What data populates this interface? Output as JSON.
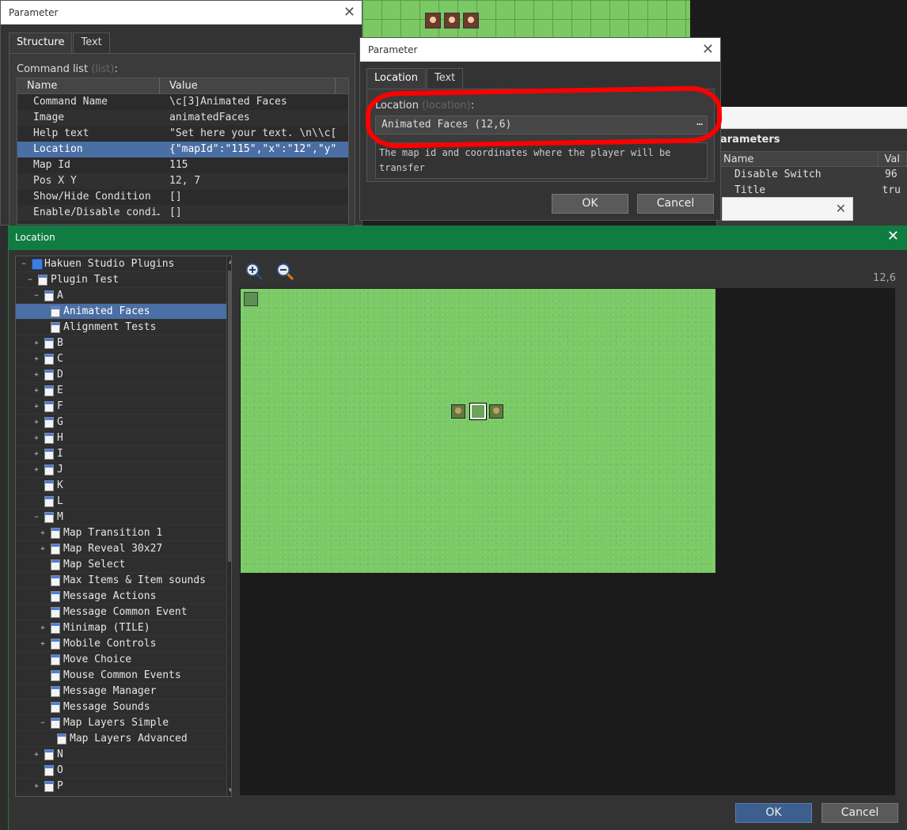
{
  "background": {
    "parameters_panel": {
      "title": "arameters",
      "columns": [
        "Name",
        "Val"
      ],
      "rows": [
        {
          "name": "Disable Switch",
          "value": "96"
        },
        {
          "name": "Title",
          "value": "tru"
        }
      ]
    }
  },
  "param_dialog_1": {
    "title": "Parameter",
    "tabs": [
      "Structure",
      "Text"
    ],
    "command_list_label": "Command list",
    "command_list_hint": "(list)",
    "columns": {
      "name": "Name",
      "value": "Value"
    },
    "rows": [
      {
        "name": "Command Name",
        "value": "\\c[3]Animated Faces"
      },
      {
        "name": "Image",
        "value": "animatedFaces"
      },
      {
        "name": "Help text",
        "value": "\"Set here your text. \\n\\\\c[…"
      },
      {
        "name": "Location",
        "value": "{\"mapId\":\"115\",\"x\":\"12\",\"y\"…"
      },
      {
        "name": "Map Id",
        "value": "115"
      },
      {
        "name": "Pos X Y",
        "value": "12, 7"
      },
      {
        "name": "Show/Hide Condition",
        "value": "[]"
      },
      {
        "name": "Enable/Disable condi…",
        "value": "[]"
      }
    ],
    "selected_row": 3
  },
  "param_dialog_2": {
    "title": "Parameter",
    "tabs": [
      "Location",
      "Text"
    ],
    "field_label": "Location",
    "field_hint": "(location)",
    "field_suffix": ":",
    "field_value": "Animated Faces (12,6)",
    "field_button": "…",
    "description": "The map id and coordinates where the player will be transfer",
    "ok_label": "OK",
    "cancel_label": "Cancel"
  },
  "location_dialog": {
    "title": "Location",
    "coordinate_readout": "12,6",
    "ok_label": "OK",
    "cancel_label": "Cancel",
    "tree": [
      {
        "label": "Hakuen Studio Plugins",
        "depth": 0,
        "expander": "-",
        "icon": "project"
      },
      {
        "label": "Plugin Test",
        "depth": 1,
        "expander": "-",
        "icon": "map"
      },
      {
        "label": "A",
        "depth": 2,
        "expander": "-",
        "icon": "map"
      },
      {
        "label": "Animated Faces",
        "depth": 3,
        "expander": "",
        "icon": "map",
        "selected": true
      },
      {
        "label": "Alignment Tests",
        "depth": 3,
        "expander": "",
        "icon": "map"
      },
      {
        "label": "B",
        "depth": 2,
        "expander": "+",
        "icon": "map"
      },
      {
        "label": "C",
        "depth": 2,
        "expander": "+",
        "icon": "map"
      },
      {
        "label": "D",
        "depth": 2,
        "expander": "+",
        "icon": "map"
      },
      {
        "label": "E",
        "depth": 2,
        "expander": "+",
        "icon": "map"
      },
      {
        "label": "F",
        "depth": 2,
        "expander": "+",
        "icon": "map"
      },
      {
        "label": "G",
        "depth": 2,
        "expander": "+",
        "icon": "map"
      },
      {
        "label": "H",
        "depth": 2,
        "expander": "+",
        "icon": "map"
      },
      {
        "label": "I",
        "depth": 2,
        "expander": "+",
        "icon": "map"
      },
      {
        "label": "J",
        "depth": 2,
        "expander": "+",
        "icon": "map"
      },
      {
        "label": "K",
        "depth": 2,
        "expander": "",
        "icon": "map"
      },
      {
        "label": "L",
        "depth": 2,
        "expander": "",
        "icon": "map"
      },
      {
        "label": "M",
        "depth": 2,
        "expander": "-",
        "icon": "map"
      },
      {
        "label": "Map Transition 1",
        "depth": 3,
        "expander": "+",
        "icon": "map"
      },
      {
        "label": "Map Reveal 30x27",
        "depth": 3,
        "expander": "+",
        "icon": "map"
      },
      {
        "label": "Map Select",
        "depth": 3,
        "expander": "",
        "icon": "map"
      },
      {
        "label": "Max Items & Item sounds",
        "depth": 3,
        "expander": "",
        "icon": "map"
      },
      {
        "label": "Message Actions",
        "depth": 3,
        "expander": "",
        "icon": "map"
      },
      {
        "label": "Message Common Event",
        "depth": 3,
        "expander": "",
        "icon": "map"
      },
      {
        "label": "Minimap (TILE)",
        "depth": 3,
        "expander": "+",
        "icon": "map"
      },
      {
        "label": "Mobile Controls",
        "depth": 3,
        "expander": "+",
        "icon": "map"
      },
      {
        "label": "Move Choice",
        "depth": 3,
        "expander": "",
        "icon": "map"
      },
      {
        "label": "Mouse Common Events",
        "depth": 3,
        "expander": "",
        "icon": "map"
      },
      {
        "label": "Message Manager",
        "depth": 3,
        "expander": "",
        "icon": "map"
      },
      {
        "label": "Message Sounds",
        "depth": 3,
        "expander": "",
        "icon": "map"
      },
      {
        "label": "Map Layers Simple",
        "depth": 3,
        "expander": "-",
        "icon": "map"
      },
      {
        "label": "Map Layers Advanced",
        "depth": 4,
        "expander": "",
        "icon": "map"
      },
      {
        "label": "N",
        "depth": 2,
        "expander": "+",
        "icon": "map"
      },
      {
        "label": "O",
        "depth": 2,
        "expander": "",
        "icon": "map"
      },
      {
        "label": "P",
        "depth": 2,
        "expander": "+",
        "icon": "map"
      }
    ],
    "icons": {
      "zoom_in": "zoom-in-icon",
      "zoom_out": "zoom-out-icon"
    }
  },
  "annotation": {
    "color": "#ff0000",
    "shape": "hand-drawn ellipse around Location field"
  },
  "colors": {
    "selection": "#4a6fa5",
    "titlebar_location": "#107c41",
    "grass": "#7cc968"
  }
}
